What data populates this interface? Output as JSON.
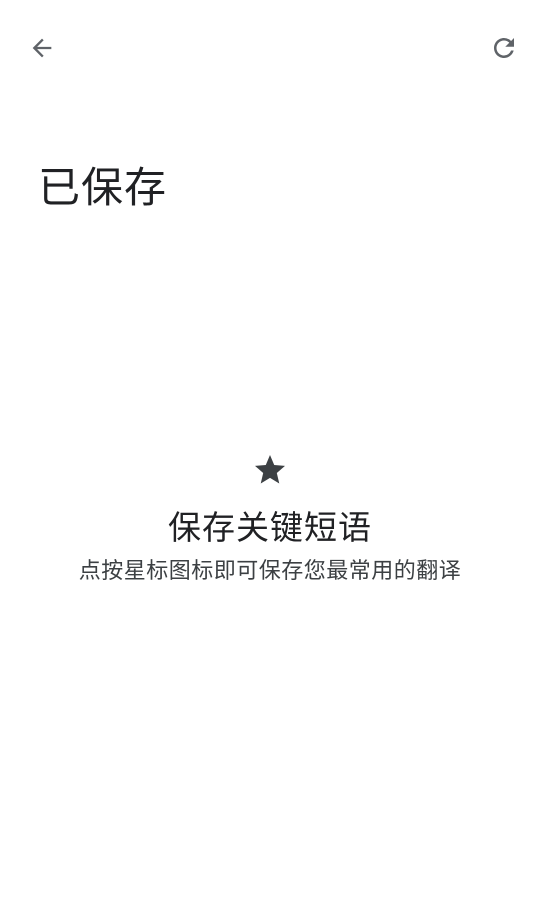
{
  "header": {
    "back_icon": "arrow-back-icon",
    "refresh_icon": "refresh-icon"
  },
  "page": {
    "title": "已保存"
  },
  "empty_state": {
    "icon": "star-icon",
    "heading": "保存关键短语",
    "description": "点按星标图标即可保存您最常用的翻译"
  },
  "colors": {
    "icon": "#5f6368",
    "star": "#3c4043",
    "text_primary": "#202124",
    "text_secondary": "#3c4043",
    "background": "#ffffff"
  }
}
